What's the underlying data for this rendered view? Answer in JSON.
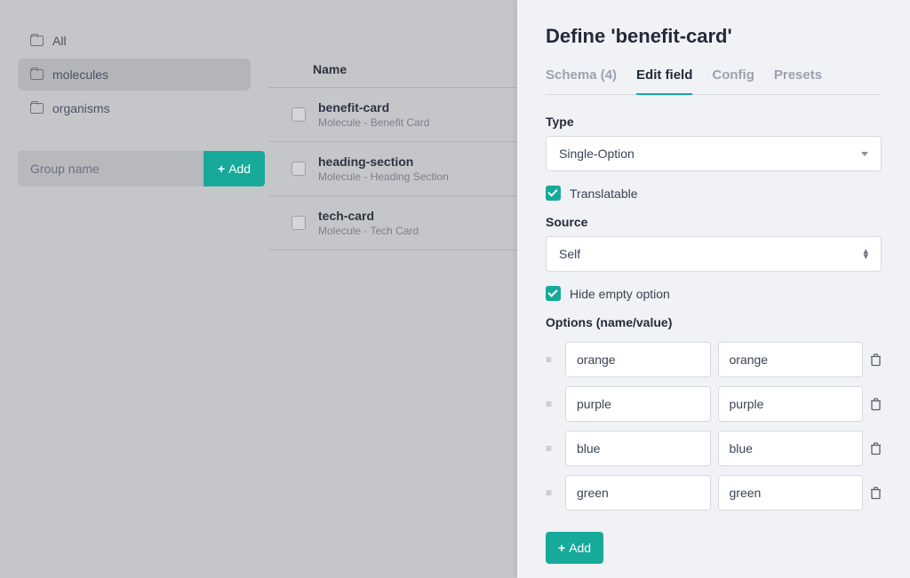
{
  "sidebar": {
    "items": [
      {
        "label": "All",
        "active": false
      },
      {
        "label": "molecules",
        "active": true
      },
      {
        "label": "organisms",
        "active": false
      }
    ],
    "group_placeholder": "Group name",
    "add_label": "Add"
  },
  "table": {
    "header": "Name",
    "rows": [
      {
        "title": "benefit-card",
        "sub": "Molecule - Benefit Card"
      },
      {
        "title": "heading-section",
        "sub": "Molecule - Heading Section"
      },
      {
        "title": "tech-card",
        "sub": "Molecule - Tech Card"
      }
    ]
  },
  "panel": {
    "title": "Define 'benefit-card'",
    "tabs": [
      {
        "label": "Schema (4)",
        "active": false
      },
      {
        "label": "Edit field",
        "active": true
      },
      {
        "label": "Config",
        "active": false
      },
      {
        "label": "Presets",
        "active": false
      }
    ],
    "type_label": "Type",
    "type_value": "Single-Option",
    "translatable_label": "Translatable",
    "source_label": "Source",
    "source_value": "Self",
    "hide_empty_label": "Hide empty option",
    "options_label": "Options (name/value)",
    "options": [
      {
        "name": "orange",
        "value": "orange"
      },
      {
        "name": "purple",
        "value": "purple"
      },
      {
        "name": "blue",
        "value": "blue"
      },
      {
        "name": "green",
        "value": "green"
      }
    ],
    "add_option_label": "Add"
  }
}
